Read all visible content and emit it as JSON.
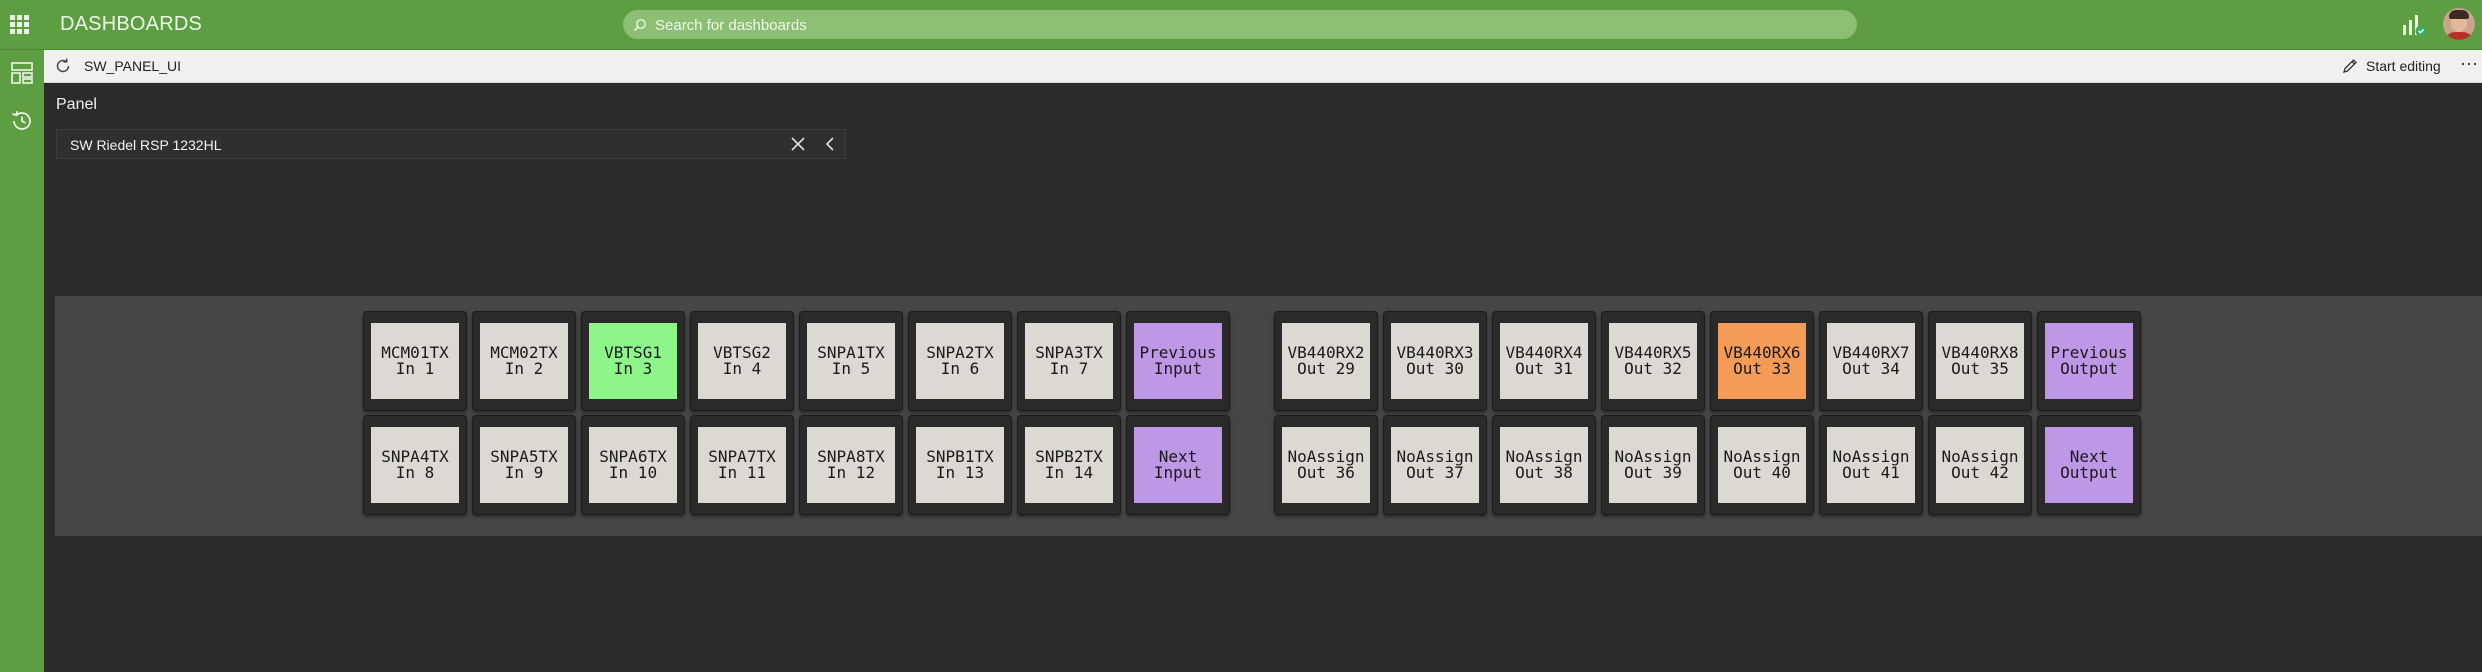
{
  "app": {
    "title": "DASHBOARDS",
    "search_placeholder": "Search for dashboards"
  },
  "toolbar": {
    "dashboard_name": "SW_PANEL_UI",
    "edit_label": "Start editing",
    "more_label": "⋯"
  },
  "panel": {
    "label": "Panel",
    "selected": "SW Riedel RSP 1232HL"
  },
  "keys": {
    "row1_left": [
      {
        "line1": "MCM01TX",
        "line2": "In 1",
        "color": "default"
      },
      {
        "line1": "MCM02TX",
        "line2": "In 2",
        "color": "default"
      },
      {
        "line1": "VBTSG1",
        "line2": "In 3",
        "color": "green"
      },
      {
        "line1": "VBTSG2",
        "line2": "In 4",
        "color": "default"
      },
      {
        "line1": "SNPA1TX",
        "line2": "In 5",
        "color": "default"
      },
      {
        "line1": "SNPA2TX",
        "line2": "In 6",
        "color": "default"
      },
      {
        "line1": "SNPA3TX",
        "line2": "In 7",
        "color": "default"
      },
      {
        "line1": "Previous",
        "line2": "Input",
        "color": "purple"
      }
    ],
    "row1_right": [
      {
        "line1": "VB440RX2",
        "line2": "Out 29",
        "color": "default"
      },
      {
        "line1": "VB440RX3",
        "line2": "Out 30",
        "color": "default"
      },
      {
        "line1": "VB440RX4",
        "line2": "Out 31",
        "color": "default"
      },
      {
        "line1": "VB440RX5",
        "line2": "Out 32",
        "color": "default"
      },
      {
        "line1": "VB440RX6",
        "line2": "Out 33",
        "color": "orange"
      },
      {
        "line1": "VB440RX7",
        "line2": "Out 34",
        "color": "default"
      },
      {
        "line1": "VB440RX8",
        "line2": "Out 35",
        "color": "default"
      },
      {
        "line1": "Previous",
        "line2": "Output",
        "color": "purple"
      }
    ],
    "row2_left": [
      {
        "line1": "SNPA4TX",
        "line2": "In 8",
        "color": "default"
      },
      {
        "line1": "SNPA5TX",
        "line2": "In 9",
        "color": "default"
      },
      {
        "line1": "SNPA6TX",
        "line2": "In 10",
        "color": "default"
      },
      {
        "line1": "SNPA7TX",
        "line2": "In 11",
        "color": "default"
      },
      {
        "line1": "SNPA8TX",
        "line2": "In 12",
        "color": "default"
      },
      {
        "line1": "SNPB1TX",
        "line2": "In 13",
        "color": "default"
      },
      {
        "line1": "SNPB2TX",
        "line2": "In 14",
        "color": "default"
      },
      {
        "line1": "Next",
        "line2": "Input",
        "color": "purple"
      }
    ],
    "row2_right": [
      {
        "line1": "NoAssign",
        "line2": "Out 36",
        "color": "default"
      },
      {
        "line1": "NoAssign",
        "line2": "Out 37",
        "color": "default"
      },
      {
        "line1": "NoAssign",
        "line2": "Out 38",
        "color": "default"
      },
      {
        "line1": "NoAssign",
        "line2": "Out 39",
        "color": "default"
      },
      {
        "line1": "NoAssign",
        "line2": "Out 40",
        "color": "default"
      },
      {
        "line1": "NoAssign",
        "line2": "Out 41",
        "color": "default"
      },
      {
        "line1": "NoAssign",
        "line2": "Out 42",
        "color": "default"
      },
      {
        "line1": "Next",
        "line2": "Output",
        "color": "purple"
      }
    ]
  },
  "colors": {
    "brand_green": "#5e9e43",
    "key_default": "#dcd9d2",
    "key_green": "#8ef58b",
    "key_purple": "#be97e6",
    "key_orange": "#f49b58"
  },
  "icons": {
    "app_launcher": "grid-icon",
    "search": "search-icon",
    "status": "signal-status-icon",
    "refresh": "refresh-icon",
    "edit": "pencil-icon",
    "rail_dashboards": "dashboard-icon",
    "rail_history": "history-icon",
    "clear": "close-icon",
    "collapse": "chevron-left-icon"
  }
}
